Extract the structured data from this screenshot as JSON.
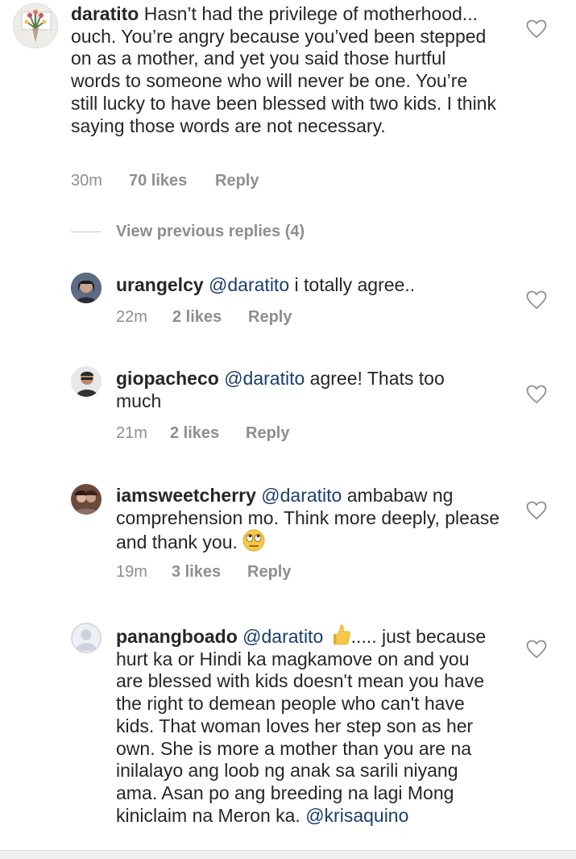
{
  "top_comment": {
    "username": "daratito",
    "text": "Hasn’t had the privilege of motherhood... ouch. You’re angry because you’ved been stepped on as a mother, and yet you said those hurtful words to someone who will never be one. You’re still lucky to have been blessed with two kids. I think saying those words are not necessary.",
    "time": "30m",
    "likes": "70 likes",
    "reply": "Reply"
  },
  "view_previous": "View previous replies (4)",
  "replies": [
    {
      "username": "urangelcy",
      "mention": "@daratito",
      "text": "i totally agree..",
      "time": "22m",
      "likes": "2 likes",
      "reply": "Reply"
    },
    {
      "username": "giopacheco",
      "mention": "@daratito",
      "text": "agree! Thats too much",
      "time": "21m",
      "likes": "2 likes",
      "reply": "Reply"
    },
    {
      "username": "iamsweetcherry",
      "mention": "@daratito",
      "text": "ambabaw ng comprehension mo. Think more deeply, please and thank you.",
      "time": "19m",
      "likes": "3 likes",
      "reply": "Reply"
    },
    {
      "username": "panangboado",
      "mention": "@daratito",
      "text_after_emoji": "..... just because hurt ka or Hindi ka magkamove on and you are blessed with kids doesn't mean you have the right to demean people who can't have kids. That woman loves her step son as her own. She is more a mother than you are na inilalayo ang loob ng anak sa sarili niyang ama. Asan po  ang breeding na lagi Mong kiniclaim na Meron ka.",
      "trailing_mention": "@krisaquino"
    }
  ],
  "icons": {
    "like": "heart-outline-icon",
    "eye_roll": "eye-roll-emoji",
    "thumbs_up": "thumbs-up-emoji"
  },
  "colors": {
    "text": "#262626",
    "meta": "#8e8e8e",
    "mention": "#1a3d6e"
  }
}
